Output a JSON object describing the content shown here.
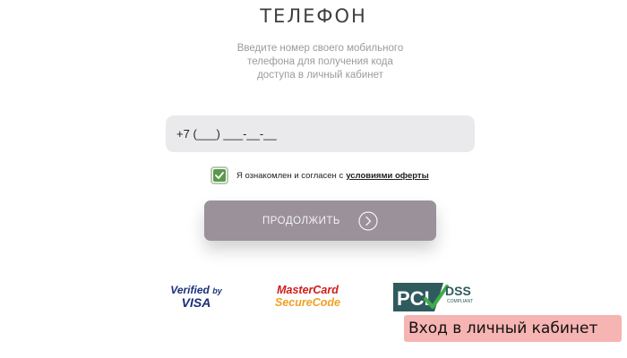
{
  "form": {
    "title": "ТЕЛЕФОН",
    "subtitle_lines": [
      "Введите номер своего мобильного",
      "телефона для получения кода",
      "доступа в личный кабинет"
    ],
    "phone_prefix": "+7",
    "phone_mask": " (___) ___-__-__",
    "agreement_text": "Я ознакомлен и согласен с",
    "agreement_link": "условиями оферты",
    "agreement_checked": true,
    "continue_label": "ПРОДОЛЖИТЬ"
  },
  "logos": {
    "visa_line1": "Verified",
    "visa_by": "by",
    "visa_line2": "VISA",
    "mastercard_line1": "MasterCard",
    "mastercard_line2": "SecureCode",
    "pci_text": "PCI",
    "dss_text": "DSS",
    "dss_compliant": "COMPLIANT"
  },
  "tooltip": {
    "text": "Вход в личный кабинет"
  },
  "colors": {
    "button_bg": "#9a919a",
    "checkbox_green": "#5a9a4b",
    "field_bg": "#eaeaec",
    "tooltip_bg": "#f6b4b2"
  },
  "icons": {
    "continue_arrow": "chevron-right-circle-icon",
    "checkbox_mark": "checkmark-icon"
  }
}
